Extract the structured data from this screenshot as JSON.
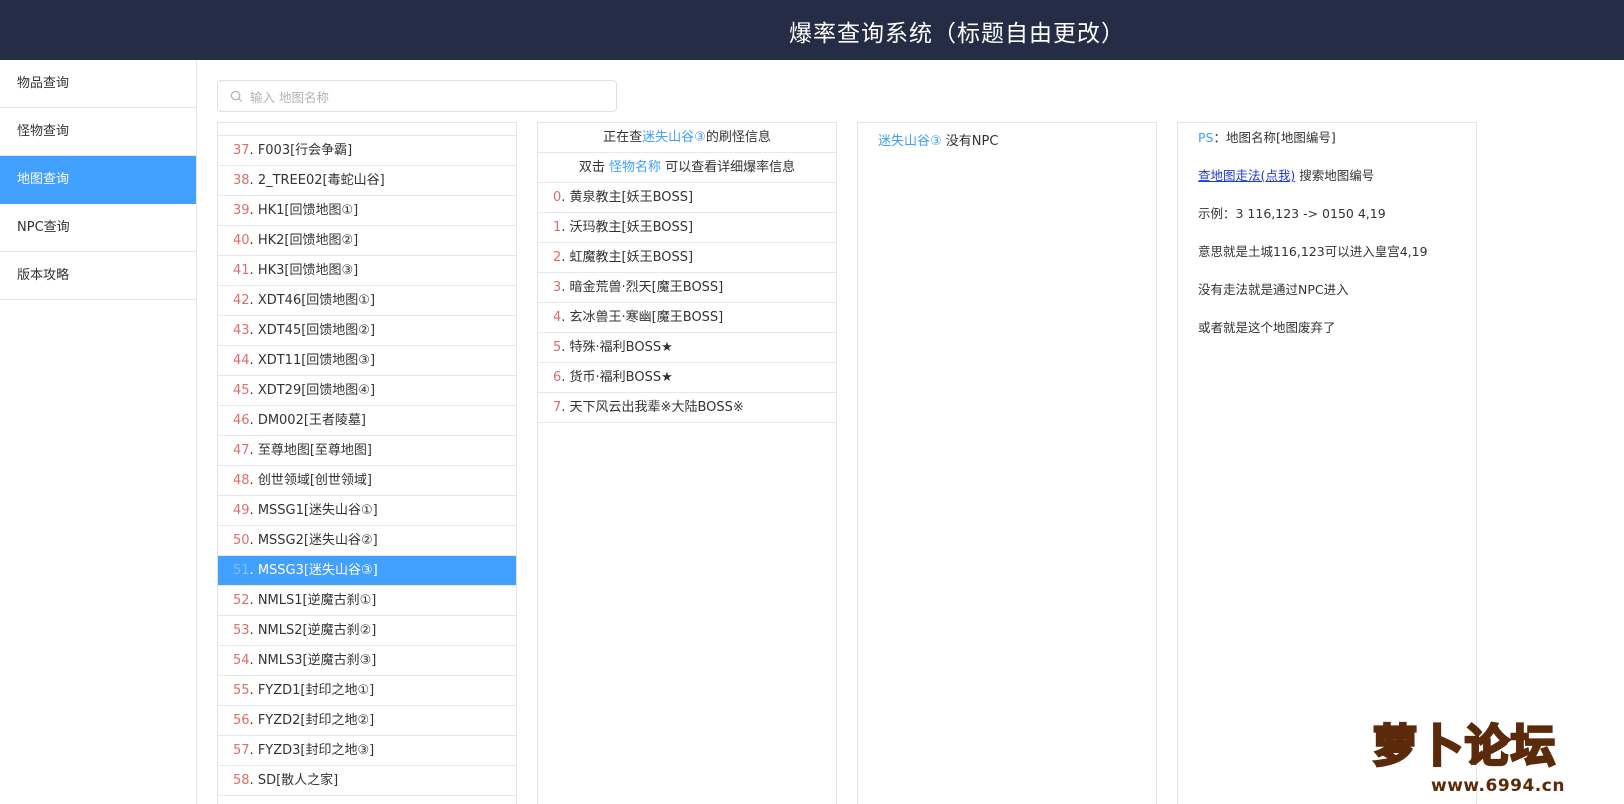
{
  "header": {
    "title": "爆率查询系统（标题自由更改）"
  },
  "sidebar": {
    "items": [
      {
        "label": "物品查询",
        "active": false
      },
      {
        "label": "怪物查询",
        "active": false
      },
      {
        "label": "地图查询",
        "active": true
      },
      {
        "label": "NPC查询",
        "active": false
      },
      {
        "label": "版本攻略",
        "active": false
      }
    ]
  },
  "search": {
    "placeholder": "输入 地图名称"
  },
  "maps": [
    {
      "num": "37",
      "name": "F003[行会争霸]"
    },
    {
      "num": "38",
      "name": "2_TREE02[毒蛇山谷]"
    },
    {
      "num": "39",
      "name": "HK1[回馈地图①]"
    },
    {
      "num": "40",
      "name": "HK2[回馈地图②]"
    },
    {
      "num": "41",
      "name": "HK3[回馈地图③]"
    },
    {
      "num": "42",
      "name": "XDT46[回馈地图①]"
    },
    {
      "num": "43",
      "name": "XDT45[回馈地图②]"
    },
    {
      "num": "44",
      "name": "XDT11[回馈地图③]"
    },
    {
      "num": "45",
      "name": "XDT29[回馈地图④]"
    },
    {
      "num": "46",
      "name": "DM002[王者陵墓]"
    },
    {
      "num": "47",
      "name": "至尊地图[至尊地图]"
    },
    {
      "num": "48",
      "name": "创世领域[创世领域]"
    },
    {
      "num": "49",
      "name": "MSSG1[迷失山谷①]"
    },
    {
      "num": "50",
      "name": "MSSG2[迷失山谷②]"
    },
    {
      "num": "51",
      "name": "MSSG3[迷失山谷③]",
      "selected": true
    },
    {
      "num": "52",
      "name": "NMLS1[逆魔古刹①]"
    },
    {
      "num": "53",
      "name": "NMLS2[逆魔古刹②]"
    },
    {
      "num": "54",
      "name": "NMLS3[逆魔古刹③]"
    },
    {
      "num": "55",
      "name": "FYZD1[封印之地①]"
    },
    {
      "num": "56",
      "name": "FYZD2[封印之地②]"
    },
    {
      "num": "57",
      "name": "FYZD3[封印之地③]"
    },
    {
      "num": "58",
      "name": "SD[散人之家]"
    }
  ],
  "monsters": {
    "header1_prefix": "正在查",
    "header1_map": "迷失山谷③",
    "header1_suffix": "的刷怪信息",
    "header2_prefix": "双击 ",
    "header2_link": "怪物名称",
    "header2_suffix": " 可以查看详细爆率信息",
    "items": [
      {
        "num": "0",
        "name": "黄泉教主[妖王BOSS]"
      },
      {
        "num": "1",
        "name": "沃玛教主[妖王BOSS]"
      },
      {
        "num": "2",
        "name": "虹魔教主[妖王BOSS]"
      },
      {
        "num": "3",
        "name": "暗金荒兽·烈天[魔王BOSS]"
      },
      {
        "num": "4",
        "name": "玄冰兽王·寒幽[魔王BOSS]"
      },
      {
        "num": "5",
        "name": "特殊·福利BOSS★"
      },
      {
        "num": "6",
        "name": "货币·福利BOSS★"
      },
      {
        "num": "7",
        "name": "天下风云出我辈※大陆BOSS※"
      }
    ]
  },
  "npc": {
    "map": "迷失山谷③",
    "text": " 没有NPC"
  },
  "ps": {
    "label": "PS",
    "line1": "：地图名称[地图编号]",
    "link": "查地图走法(点我)",
    "line2": " 搜索地图编号",
    "line3": "示例：3 116,123 -> 0150 4,19",
    "line4": "意思就是土城116,123可以进入皇宫4,19",
    "line5": "没有走法就是通过NPC进入",
    "line6": "或者就是这个地图废弃了"
  },
  "watermark": {
    "brand": "萝卜论坛",
    "url": "www.6994.cn",
    "colors": {
      "fill": "#ffd23a",
      "outline": "#5a2a0a"
    }
  }
}
